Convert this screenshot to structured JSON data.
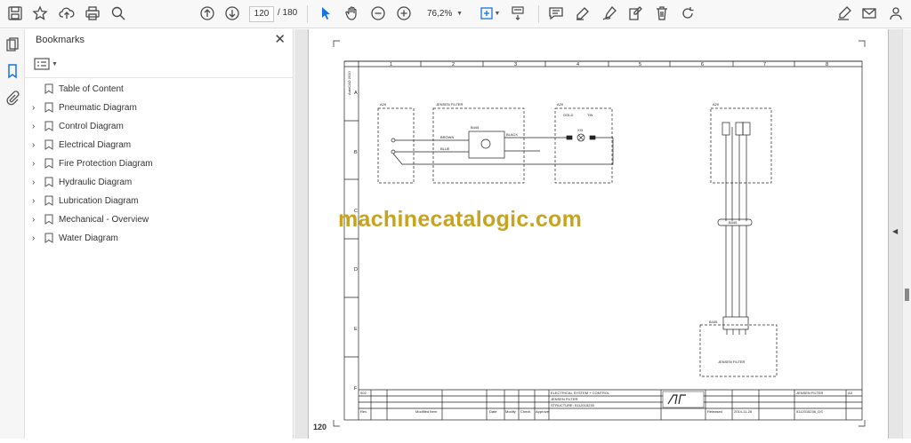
{
  "toolbar": {
    "page_current": "120",
    "page_total": "/ 180",
    "zoom": "76,2%"
  },
  "bookmarks": {
    "title": "Bookmarks",
    "items": [
      {
        "label": "Table of Content",
        "expandable": false
      },
      {
        "label": "Pneumatic Diagram",
        "expandable": true
      },
      {
        "label": "Control Diagram",
        "expandable": true
      },
      {
        "label": "Electrical Diagram",
        "expandable": true
      },
      {
        "label": "Fire Protection Diagram",
        "expandable": true
      },
      {
        "label": "Hydraulic Diagram",
        "expandable": true
      },
      {
        "label": "Lubrication Diagram",
        "expandable": true
      },
      {
        "label": "Mechanical - Overview",
        "expandable": true
      },
      {
        "label": "Water Diagram",
        "expandable": true
      }
    ]
  },
  "document": {
    "watermark": "machinecatalogic.com",
    "page_number": "120",
    "drawing": {
      "columns": [
        "1",
        "2",
        "3",
        "4",
        "5",
        "6",
        "7",
        "8"
      ],
      "rows": [
        "A",
        "B",
        "C",
        "D",
        "E",
        "F"
      ],
      "side_note": "AutoCAD 2010",
      "block_a20_left": "A20",
      "jensen_filter_title": "JENSEN FILTER",
      "b445": "B445",
      "brown": "BROWN",
      "black": "BLACK",
      "blue": "BLUE",
      "a20_mid": "A20",
      "gold": "GOLD",
      "tin": "TIN",
      "xi3": "XI3",
      "a20_right": "A20",
      "connector_mid": "B445",
      "b445_bottom": "B445",
      "jensen_filter_bottom": "JENSEN FILTER",
      "title_line1": "ELECTRICAL SYSTEM + CONTROL",
      "title_line2": "JENSEN FILTER",
      "structure": "STRUCTURE: 5112015230",
      "revision": "002",
      "date_rel": "2014-11-26",
      "released": "Released",
      "drawing_title_r": "JENSEN FILTER",
      "sheet": "A3",
      "doc_number": "5112015236_DS",
      "rev_row_label": "Rev.",
      "modified_label": "Modified Item",
      "date_label": "Date",
      "modify_label": "Modify",
      "check_label": "Check",
      "approve_label": "Approve"
    }
  }
}
